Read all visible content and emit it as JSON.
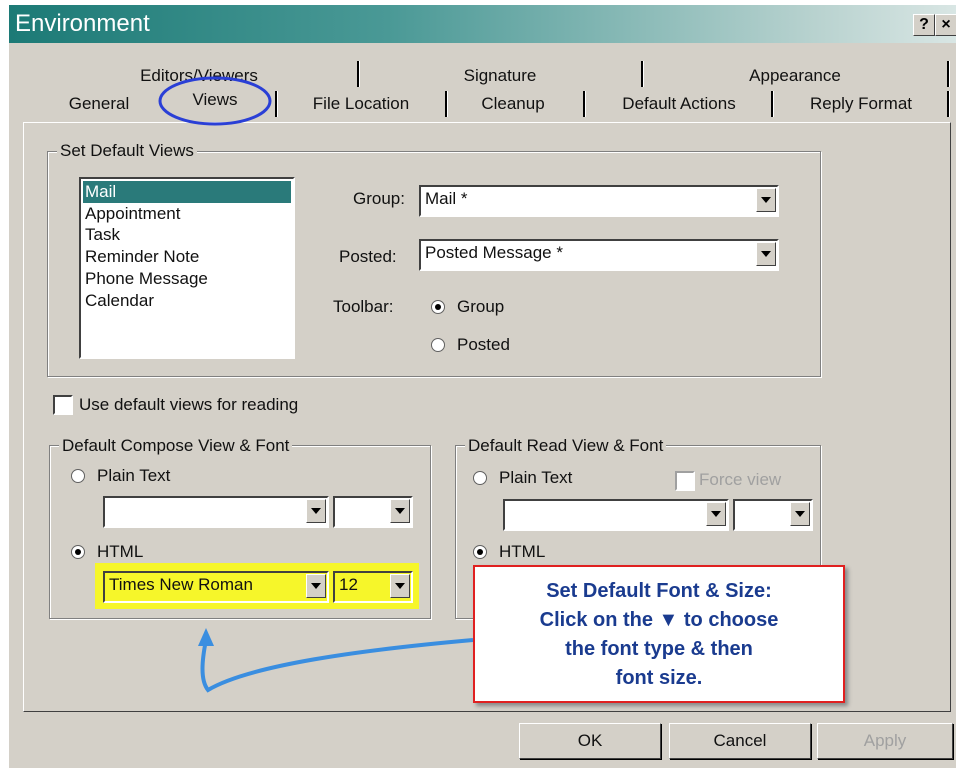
{
  "window": {
    "title": "Environment",
    "help_label": "?",
    "close_label": "×"
  },
  "tabs": {
    "row1": [
      "Editors/Viewers",
      "Signature",
      "Appearance"
    ],
    "row2": [
      "General",
      "Views",
      "File Location",
      "Cleanup",
      "Default Actions",
      "Reply Format"
    ],
    "active": "Views"
  },
  "default_views": {
    "legend": "Set Default Views",
    "items": [
      "Mail",
      "Appointment",
      "Task",
      "Reminder Note",
      "Phone Message",
      "Calendar"
    ],
    "selected": "Mail",
    "group_label": "Group:",
    "group_value": "Mail *",
    "posted_label": "Posted:",
    "posted_value": "Posted Message *",
    "toolbar_label": "Toolbar:",
    "toolbar_group": "Group",
    "toolbar_posted": "Posted"
  },
  "use_default_views": "Use default views for reading",
  "compose": {
    "legend": "Default Compose View & Font",
    "plain_text": "Plain Text",
    "html": "HTML",
    "font": "Times New Roman",
    "size": "12"
  },
  "read": {
    "legend": "Default Read View & Font",
    "plain_text": "Plain Text",
    "force_view": "Force view",
    "html": "HTML"
  },
  "callout": {
    "lines": [
      "Set Default Font & Size:",
      "Click on the ▼ to choose",
      "the font type & then",
      "font size."
    ]
  },
  "buttons": {
    "ok": "OK",
    "cancel": "Cancel",
    "apply": "Apply"
  },
  "colors": {
    "title_start": "#1c7a76",
    "highlight": "#f6f62a",
    "annotation_circle": "#2a3fd6",
    "arrow": "#3a8ee0",
    "callout_border": "#e02020",
    "callout_text": "#1a3b8f"
  }
}
